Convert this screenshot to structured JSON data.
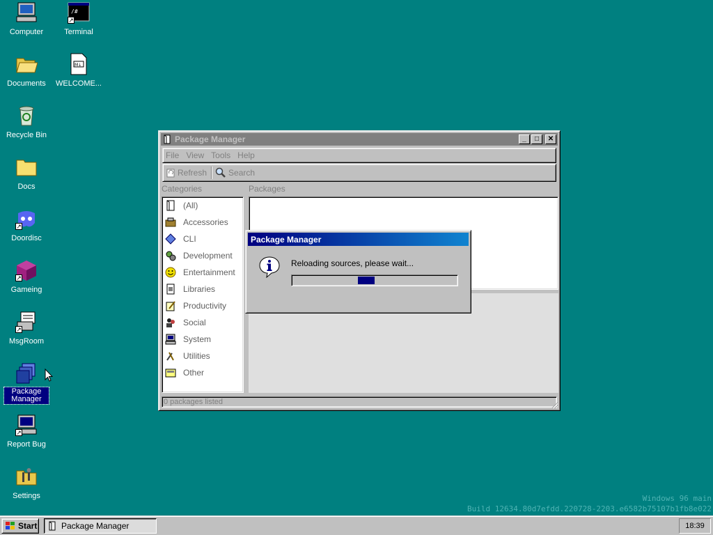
{
  "desktop": {
    "icons": [
      {
        "label": "Computer"
      },
      {
        "label": "Terminal"
      },
      {
        "label": "Documents"
      },
      {
        "label": "WELCOME..."
      },
      {
        "label": "Recycle Bin"
      },
      {
        "label": "Docs"
      },
      {
        "label": "Doordisc"
      },
      {
        "label": "Gameing"
      },
      {
        "label": "MsgRoom"
      },
      {
        "label": "Package Manager"
      },
      {
        "label": "Report Bug"
      },
      {
        "label": "Settings"
      }
    ]
  },
  "window": {
    "title": "Package Manager",
    "menu": [
      "File",
      "View",
      "Tools",
      "Help"
    ],
    "toolbar": {
      "refresh": "Refresh",
      "search": "Search"
    },
    "categories_header": "Categories",
    "packages_header": "Packages",
    "categories": [
      "(All)",
      "Accessories",
      "CLI",
      "Development",
      "Entertainment",
      "Libraries",
      "Productivity",
      "Social",
      "System",
      "Utilities",
      "Other"
    ],
    "status": "0 packages listed"
  },
  "dialog": {
    "title": "Package Manager",
    "message": "Reloading sources, please wait...",
    "progress_fraction": 0.45
  },
  "taskbar": {
    "start_label": "Start",
    "task_label": "Package Manager",
    "clock": "18:39"
  },
  "watermark": {
    "line1": "Windows 96 main",
    "line2": "Build 12634.80d7efdd.220728-2203.e6582b75107b1fb8e022"
  }
}
